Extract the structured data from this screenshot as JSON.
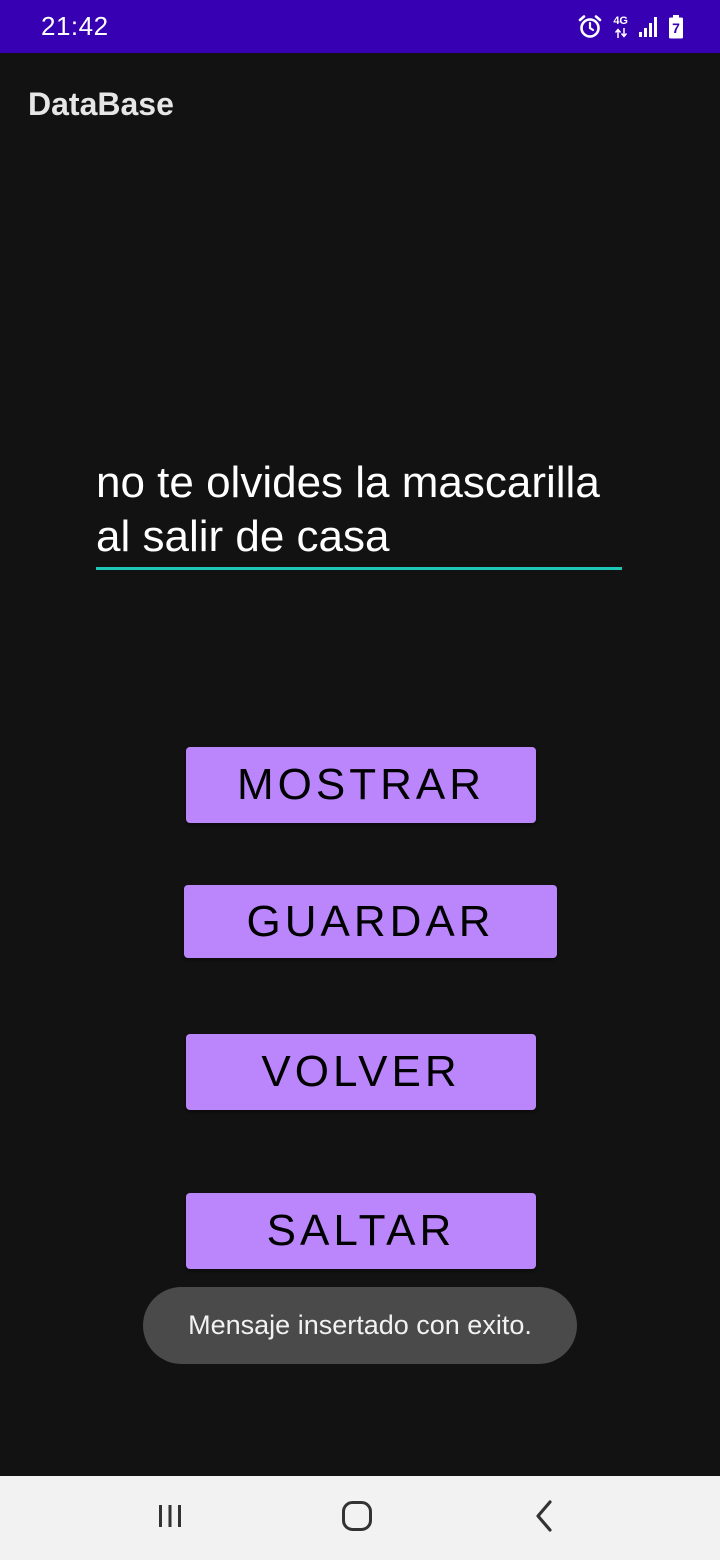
{
  "status_bar": {
    "time": "21:42",
    "network_label": "4G",
    "battery_level": "7",
    "icons": [
      "alarm-icon",
      "network-4g-icon",
      "signal-icon",
      "battery-icon"
    ]
  },
  "app_bar": {
    "title": "DataBase"
  },
  "note_field": {
    "value": "no te olvides la mascarilla al salir de casa"
  },
  "buttons": {
    "mostrar": "MOSTRAR",
    "guardar": "GUARDAR",
    "volver": "VOLVER",
    "saltar": "SALTAR"
  },
  "toast": {
    "message": "Mensaje insertado con exito."
  },
  "nav_bar": {
    "icons": [
      "recents-icon",
      "home-icon",
      "back-icon"
    ]
  },
  "colors": {
    "status_bar": "#3700B3",
    "background": "#121212",
    "button": "#BB86FC",
    "field_underline": "#1EC8B6",
    "toast": "#4A4A4A",
    "nav_bar": "#F2F2F2"
  }
}
